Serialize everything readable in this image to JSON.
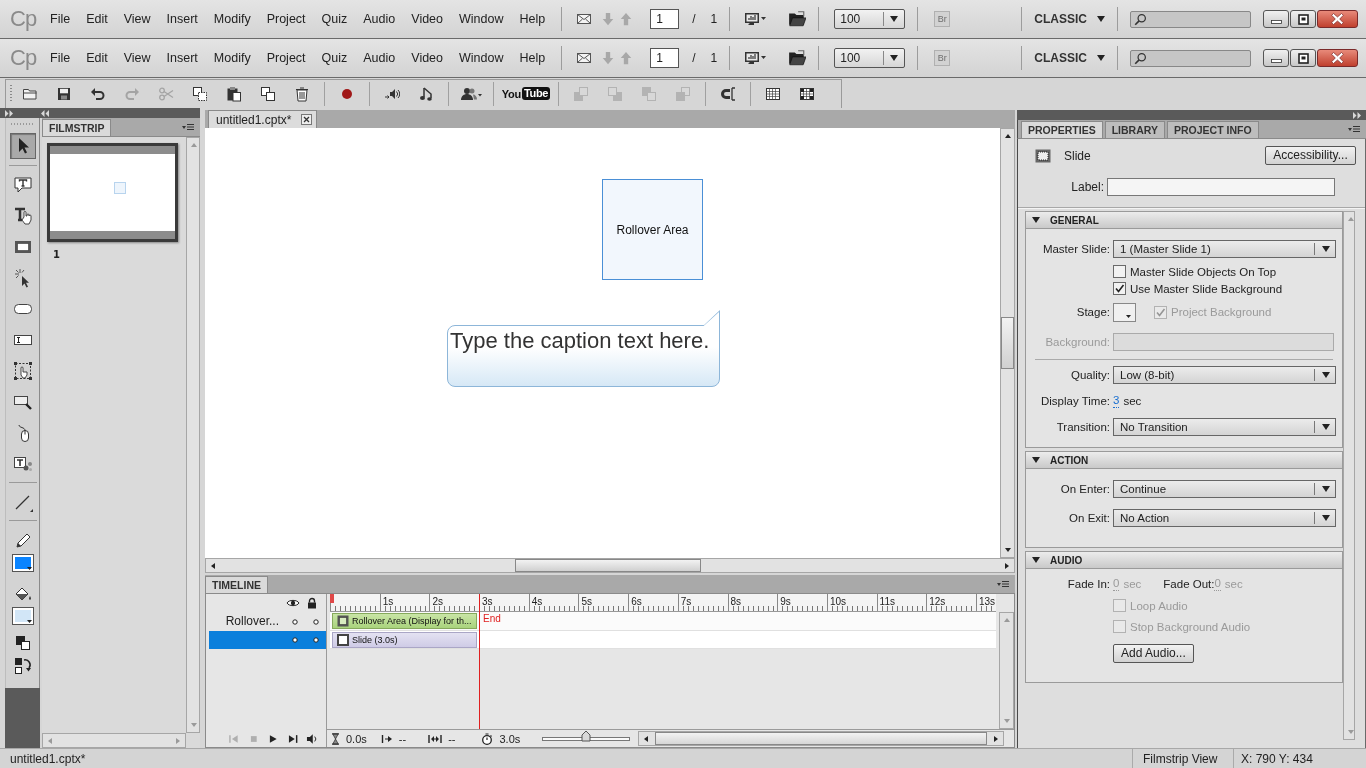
{
  "menu_bars": [
    {
      "logo": "Cp",
      "menus": [
        "File",
        "Edit",
        "View",
        "Insert",
        "Modify",
        "Project",
        "Quiz",
        "Audio",
        "Video",
        "Window",
        "Help"
      ],
      "page": {
        "current": "1",
        "separator": "/",
        "total": "1"
      },
      "zoom": "100",
      "bridge": "Br",
      "workspace": "CLASSIC"
    },
    {
      "logo": "Cp",
      "menus": [
        "File",
        "Edit",
        "View",
        "Insert",
        "Modify",
        "Project",
        "Quiz",
        "Audio",
        "Video",
        "Window",
        "Help"
      ],
      "page": {
        "current": "1",
        "separator": "/",
        "total": "1"
      },
      "zoom": "100",
      "bridge": "Br",
      "workspace": "CLASSIC"
    }
  ],
  "toolbar": {
    "groups": [
      [
        {
          "kind": "icon",
          "disabled": false
        },
        {
          "kind": "icon",
          "disabled": false
        },
        {
          "kind": "icon",
          "disabled": false
        },
        {
          "kind": "icon",
          "disabled": true
        },
        {
          "kind": "icon",
          "disabled": true
        },
        {
          "kind": "icon",
          "disabled": false
        },
        {
          "kind": "icon",
          "disabled": false
        },
        {
          "kind": "icon",
          "disabled": false
        },
        {
          "kind": "icon",
          "disabled": false
        }
      ],
      [
        {
          "kind": "icon",
          "disabled": false
        }
      ],
      [
        {
          "kind": "icon",
          "disabled": false
        },
        {
          "kind": "icon",
          "disabled": false
        }
      ],
      [
        {
          "kind": "icon",
          "disabled": false
        }
      ],
      [
        {
          "kind": "logo",
          "text": "You",
          "badge": "Tube"
        }
      ],
      [
        {
          "kind": "icon",
          "disabled": true
        },
        {
          "kind": "icon",
          "disabled": true
        },
        {
          "kind": "icon",
          "disabled": true
        },
        {
          "kind": "icon",
          "disabled": true
        }
      ],
      [
        {
          "kind": "icon",
          "disabled": false
        }
      ],
      [
        {
          "kind": "icon",
          "disabled": false
        },
        {
          "kind": "icon",
          "disabled": false
        }
      ]
    ]
  },
  "tools": [
    {
      "selected": true
    },
    {
      "selected": false
    },
    {
      "selected": false
    },
    {
      "selected": false
    },
    {
      "selected": false
    },
    {
      "selected": false
    },
    {
      "selected": false
    },
    {
      "selected": false
    },
    {
      "selected": false
    },
    {
      "selected": false
    },
    {
      "selected": false
    },
    {
      "selected": false
    }
  ],
  "colors": [
    {
      "color": "#0a84ff"
    },
    {
      "color": "#d2e6f7"
    }
  ],
  "filmstrip": {
    "tab": "FILMSTRIP",
    "slides": [
      {
        "number": "1",
        "selected": true
      }
    ]
  },
  "document_tabs": [
    {
      "title": "untitled1.cptx*",
      "selected": true
    }
  ],
  "stage": {
    "rollover_area": "Rollover Area",
    "caption": "Type the caption text here."
  },
  "timeline": {
    "tab": "TIMELINE",
    "layers": [
      {
        "name": "Rollover...",
        "selected": false,
        "bar": "Rollover Area (Display for th...",
        "kind": "object"
      },
      {
        "selected": true,
        "bar": "Slide (3.0s)",
        "kind": "slide"
      }
    ],
    "ruler": [
      "1s",
      "2s",
      "3s",
      "4s",
      "5s",
      "6s",
      "7s",
      "8s",
      "9s",
      "10s",
      "11s",
      "12s",
      "13s"
    ],
    "end_marker": "End",
    "start_time": "0.0s",
    "in_point": "--",
    "out_point": "--",
    "duration": "3.0s",
    "zoom": {
      "level": 0.5
    }
  },
  "properties": {
    "tabs": [
      {
        "label": "PROPERTIES",
        "selected": true
      },
      {
        "label": "LIBRARY",
        "selected": false
      },
      {
        "label": "PROJECT INFO",
        "selected": false
      }
    ],
    "object": "Slide",
    "accessibility_button": "Accessibility...",
    "label_field": {
      "label": "Label:"
    },
    "sections": [
      {
        "title": "GENERAL",
        "expanded": true,
        "rows": [
          {
            "kind": "select",
            "label": "Master Slide:",
            "value": "1 (Master Slide 1)"
          },
          {
            "kind": "checkbox",
            "text": "Master Slide Objects On Top",
            "checked": false,
            "disabled": false
          },
          {
            "kind": "checkbox",
            "text": "Use Master Slide Background",
            "checked": true,
            "disabled": false
          },
          {
            "kind": "stage",
            "label": "Stage:",
            "text": "Project Background",
            "checked": true,
            "disabled": true
          },
          {
            "kind": "field",
            "label": "Background:",
            "disabled": true
          },
          {
            "kind": "divider"
          },
          {
            "kind": "select",
            "label": "Quality:",
            "value": "Low (8-bit)"
          },
          {
            "kind": "time",
            "label": "Display Time:",
            "value": "3",
            "unit": "sec"
          },
          {
            "kind": "select",
            "label": "Transition:",
            "value": "No Transition"
          }
        ]
      },
      {
        "title": "ACTION",
        "expanded": true,
        "rows": [
          {
            "kind": "select",
            "label": "On Enter:",
            "value": "Continue"
          },
          {
            "kind": "select",
            "label": "On Exit:",
            "value": "No Action"
          }
        ]
      },
      {
        "title": "AUDIO",
        "expanded": true,
        "rows": [
          {
            "kind": "fades",
            "items": [
              {
                "label": "Fade In:",
                "value": "0",
                "unit": "sec",
                "disabled": true
              },
              {
                "label": "Fade Out:",
                "value": "0",
                "unit": "sec",
                "disabled": true
              }
            ]
          },
          {
            "kind": "checkbox",
            "text": "Loop Audio",
            "checked": false,
            "disabled": true
          },
          {
            "kind": "checkbox",
            "text": "Stop Background Audio",
            "checked": false,
            "disabled": true
          },
          {
            "kind": "button",
            "text": "Add Audio..."
          }
        ]
      }
    ]
  },
  "status_bar": {
    "file": "untitled1.cptx*",
    "view": "Filmstrip View",
    "coordinates": "X: 790 Y: 434"
  }
}
